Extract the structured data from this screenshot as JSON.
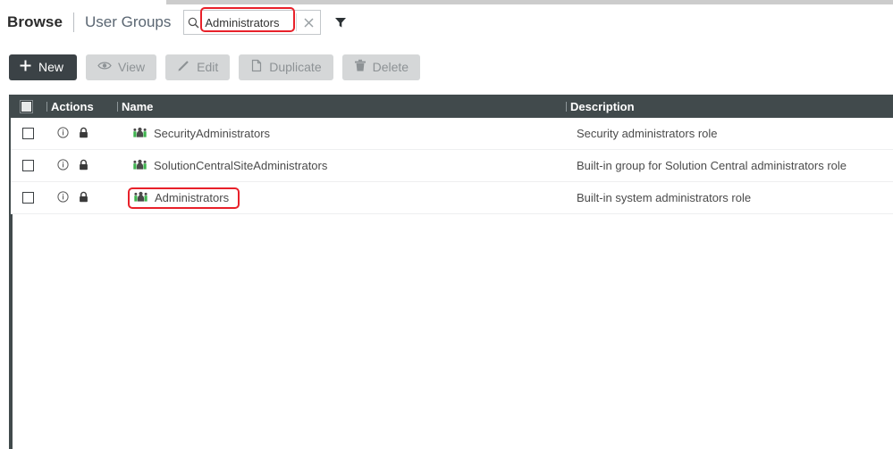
{
  "breadcrumb": {
    "root_label": "Browse",
    "current_label": "User Groups"
  },
  "search": {
    "value": "Administrators",
    "placeholder": "Search",
    "search_icon": "search-icon",
    "clear_icon": "close-icon",
    "filter_icon": "filter-icon",
    "highlight_color": "#e8212a"
  },
  "toolbar": {
    "buttons": [
      {
        "label": "New",
        "icon": "plus-icon",
        "state": "enabled"
      },
      {
        "label": "View",
        "icon": "eye-icon",
        "state": "disabled"
      },
      {
        "label": "Edit",
        "icon": "pencil-icon",
        "state": "disabled"
      },
      {
        "label": "Duplicate",
        "icon": "duplicate-icon",
        "state": "disabled"
      },
      {
        "label": "Delete",
        "icon": "trash-icon",
        "state": "disabled"
      }
    ],
    "primary_color": "#3b4246",
    "disabled_color": "#d5d7d8"
  },
  "table": {
    "header_color": "#414a4c",
    "columns": {
      "actions": "Actions",
      "name": "Name",
      "description": "Description"
    },
    "rows": [
      {
        "checked": false,
        "info_icon": "info-icon",
        "lock_icon": "lock-icon",
        "group_icon": "user-group-icon",
        "name": "SecurityAdministrators",
        "description": "Security administrators role",
        "highlighted": false
      },
      {
        "checked": false,
        "info_icon": "info-icon",
        "lock_icon": "lock-icon",
        "group_icon": "user-group-icon",
        "name": "SolutionCentralSiteAdministrators",
        "description": "Built-in group for Solution Central administrators role",
        "highlighted": false
      },
      {
        "checked": false,
        "info_icon": "info-icon",
        "lock_icon": "lock-icon",
        "group_icon": "user-group-icon",
        "name": "Administrators",
        "description": "Built-in system administrators role",
        "highlighted": true
      }
    ]
  }
}
